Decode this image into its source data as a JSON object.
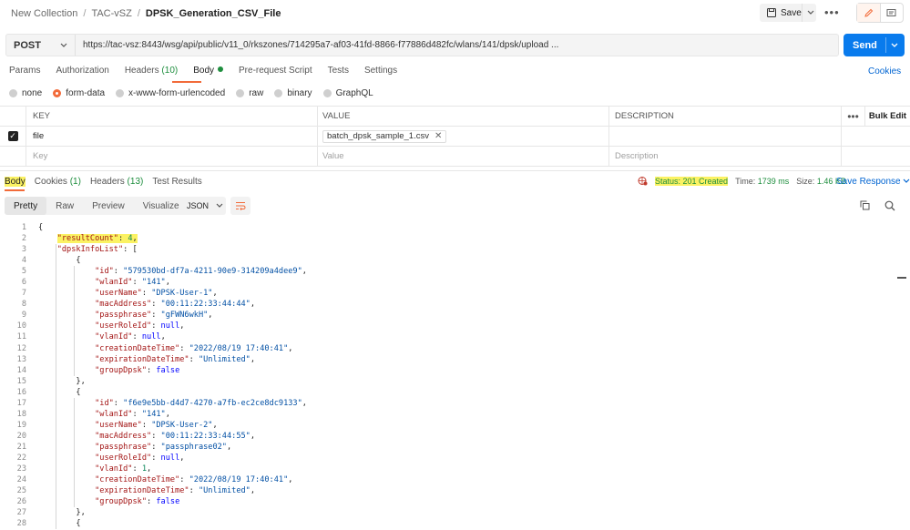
{
  "breadcrumb": {
    "collection": "New Collection",
    "folder": "TAC-vSZ",
    "request": "DPSK_Generation_CSV_File",
    "separator": "/"
  },
  "header": {
    "save_label": "Save",
    "more": "•••"
  },
  "request": {
    "method": "POST",
    "url": "https://tac-vsz:8443/wsg/api/public/v11_0/rkszones/714295a7-af03-41fd-8866-f77886d482fc/wlans/141/dpsk/upload ...",
    "send_label": "Send"
  },
  "req_tabs": {
    "params": "Params",
    "authorization": "Authorization",
    "headers": "Headers",
    "headers_count": "(10)",
    "body": "Body",
    "prerequest": "Pre-request Script",
    "tests": "Tests",
    "settings": "Settings",
    "cookies": "Cookies"
  },
  "body_types": [
    "none",
    "form-data",
    "x-www-form-urlencoded",
    "raw",
    "binary",
    "GraphQL"
  ],
  "form_table": {
    "headers": {
      "key": "KEY",
      "value": "VALUE",
      "description": "DESCRIPTION",
      "bulk_edit": "Bulk Edit"
    },
    "rows": [
      {
        "key": "file",
        "value": "batch_dpsk_sample_1.csv",
        "description": ""
      }
    ],
    "placeholders": {
      "key": "Key",
      "value": "Value",
      "description": "Description"
    }
  },
  "resp_tabs": {
    "body": "Body",
    "cookies": "Cookies",
    "cookies_count": "(1)",
    "headers": "Headers",
    "headers_count": "(13)",
    "test_results": "Test Results"
  },
  "resp_meta": {
    "status": "Status: 201 Created",
    "time_label": "Time:",
    "time_value": "1739 ms",
    "size_label": "Size:",
    "size_value": "1.46 KB",
    "save_response": "Save Response"
  },
  "view_tabs": [
    "Pretty",
    "Raw",
    "Preview",
    "Visualize"
  ],
  "format": "JSON",
  "colors": {
    "accent": "#f26b3a",
    "send": "#097bed",
    "highlight": "#fbf263",
    "green": "#1e8e3e"
  },
  "code_lines": [
    "{",
    "    \"resultCount\": 4,",
    "    \"dpskInfoList\": [",
    "        {",
    "            \"id\": \"579530bd-df7a-4211-90e9-314209a4dee9\",",
    "            \"wlanId\": \"141\",",
    "            \"userName\": \"DPSK-User-1\",",
    "            \"macAddress\": \"00:11:22:33:44:44\",",
    "            \"passphrase\": \"gFWN6wkH\",",
    "            \"userRoleId\": null,",
    "            \"vlanId\": null,",
    "            \"creationDateTime\": \"2022/08/19 17:40:41\",",
    "            \"expirationDateTime\": \"Unlimited\",",
    "            \"groupDpsk\": false",
    "        },",
    "        {",
    "            \"id\": \"f6e9e5bb-d4d7-4270-a7fb-ec2ce8dc9133\",",
    "            \"wlanId\": \"141\",",
    "            \"userName\": \"DPSK-User-2\",",
    "            \"macAddress\": \"00:11:22:33:44:55\",",
    "            \"passphrase\": \"passphrase02\",",
    "            \"userRoleId\": null,",
    "            \"vlanId\": 1,",
    "            \"creationDateTime\": \"2022/08/19 17:40:41\",",
    "            \"expirationDateTime\": \"Unlimited\",",
    "            \"groupDpsk\": false",
    "        },",
    "        {"
  ]
}
